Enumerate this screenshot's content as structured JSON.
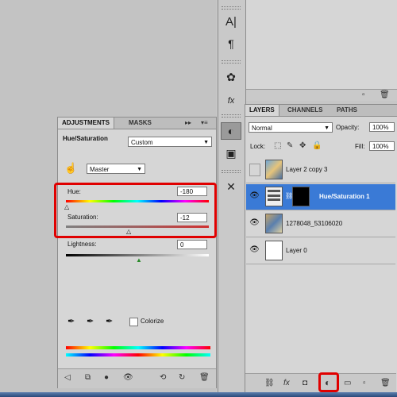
{
  "adjustments": {
    "tabs": [
      "ADJUSTMENTS",
      "MASKS"
    ],
    "title": "Hue/Saturation",
    "preset": "Custom",
    "channel": "Master",
    "hue_label": "Hue:",
    "hue_value": "-180",
    "saturation_label": "Saturation:",
    "saturation_value": "-12",
    "lightness_label": "Lightness:",
    "lightness_value": "0",
    "colorize_label": "Colorize"
  },
  "layers": {
    "tabs": [
      "LAYERS",
      "CHANNELS",
      "PATHS"
    ],
    "blend_mode": "Normal",
    "opacity_label": "Opacity:",
    "opacity_value": "100%",
    "lock_label": "Lock:",
    "fill_label": "Fill:",
    "fill_value": "100%",
    "items": [
      {
        "name": "Layer 2 copy 3",
        "visible": false
      },
      {
        "name": "Hue/Saturation 1",
        "visible": true,
        "selected": true
      },
      {
        "name": "1278048_53106020",
        "visible": true
      },
      {
        "name": "Layer 0",
        "visible": true
      }
    ]
  },
  "colors": {
    "accent": "#3a7ad6",
    "highlight": "#e00000"
  }
}
